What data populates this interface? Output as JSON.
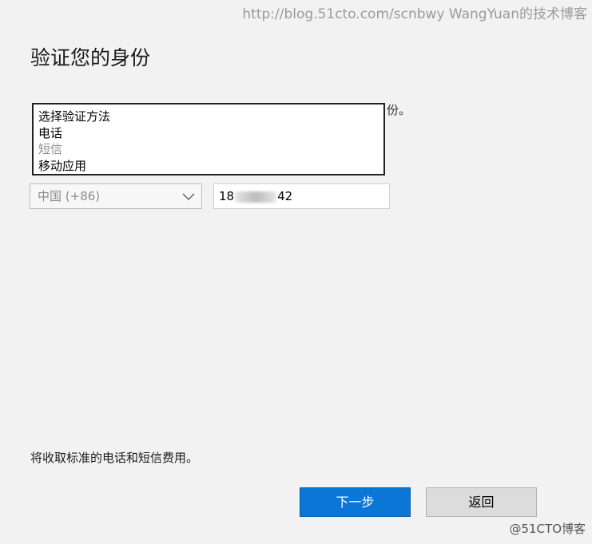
{
  "watermark": {
    "top": "http://blog.51cto.com/scnbwy WangYuan的技术博客",
    "bottom": "@51CTO博客"
  },
  "page": {
    "title": "验证您的身份",
    "instruction_tail": "份。"
  },
  "verify_method_dropdown": {
    "options": [
      {
        "label": "选择验证方法",
        "enabled": true
      },
      {
        "label": "电话",
        "enabled": true
      },
      {
        "label": "短信",
        "enabled": false
      },
      {
        "label": "移动应用",
        "enabled": true
      }
    ]
  },
  "country_select": {
    "value": "中国 (+86)",
    "icon": "chevron-down-icon"
  },
  "phone_field": {
    "prefix": "18",
    "suffix": "42"
  },
  "note": "将收取标准的电话和短信费用。",
  "buttons": {
    "next": "下一步",
    "back": "返回"
  },
  "colors": {
    "primary_button": "#0c76d6",
    "secondary_button": "#dcdcdc",
    "background": "#f2f2f2"
  }
}
